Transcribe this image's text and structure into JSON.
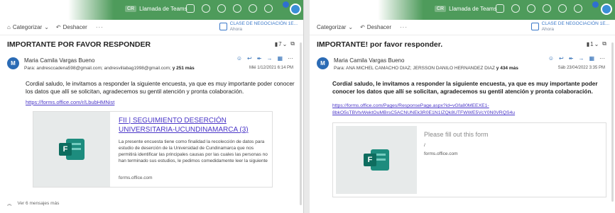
{
  "colors": {
    "accent_green": "#4e9b5b",
    "link": "#4a36c8",
    "avatar": "#2b6bb5"
  },
  "left": {
    "topbar": {
      "chip": "CR",
      "call_label": "Llamada de Teams"
    },
    "cmdbar": {
      "categorize": "Categorizar",
      "undo": "Deshacer",
      "more": "···",
      "calendar_title": "CLASE DE NEGOCIACIÓN 1E...",
      "calendar_sub": "Ahora"
    },
    "subject": "IMPORTANTE POR FAVOR RESPONDER",
    "subject_count": "7",
    "sender": {
      "avatar_letter": "M",
      "name": "Maria Camila Vargas Bueno",
      "to_prefix": "Para:",
      "to": "andresccadena598@gmail.com;  andresvillabag1998@gmail.com;",
      "more": "y 251 más",
      "date": "Mié 1/12/2021 6:14 PM"
    },
    "body": "Cordial saludo, le invitamos a responder la siguiente encuesta, ya que es muy importante poder conocer los datos que allí se solicitan, agradecemos su gentil atención y pronta colaboración.",
    "link": "https://forms.office.com/r/LbubHMNist",
    "card": {
      "title": "FII | SEGUIMIENTO DESERCIÓN UNIVERSITARIA-UCUNDINAMARCA (3)",
      "desc": "La presente encuesta tiene como finalidad la recolección de datos para estudio de deserción de la Universidad de Cundinamarca que nos permitirá identificar las principales causas por las cuales las personas no han terminado sus estudios, le pedimos comedidamente leer la siguiente",
      "domain": "forms.office.com"
    },
    "footer": "Ver 6 mensajes más"
  },
  "right": {
    "topbar": {
      "chip": "CR",
      "call_label": "Llamada de Teams"
    },
    "cmdbar": {
      "categorize": "Categorizar",
      "undo": "Deshacer",
      "more": "···",
      "calendar_title": "CLASE DE NEGOCIACIÓN 1E...",
      "calendar_sub": "Ahora"
    },
    "subject": "IMPORTANTE! por favor responder.",
    "subject_count": "1",
    "sender": {
      "avatar_letter": "M",
      "name": "Maria Camila Vargas Bueno",
      "to_prefix": "Para:",
      "to": "ANA MICHEL CAMACHO DIAZ;  JERSSON DANILO HERNANDEZ DIAZ",
      "more": "y 434 más",
      "date": "Sáb 23/04/2022 3:35 PM"
    },
    "body": "Cordial saludo, le invitamos a responder la siguiente encuesta, ya que es muy importante poder conocer los datos que allí se solicitan, agradecemos su gentil atención y pronta colaboración.",
    "link_line1": "https://forms.office.com/Pages/ResponsePage.aspx?id=vGfa80MEEXE1-",
    "link_line2": "8bkO5sTBVtvWektOuMBrsC5ACNUNEk3R0E1N1IZQk8UTFWWE5VcY0N0VRQS4u",
    "card": {
      "title": "Please fill out this form",
      "slash": "/",
      "domain": "forms.office.com"
    }
  }
}
